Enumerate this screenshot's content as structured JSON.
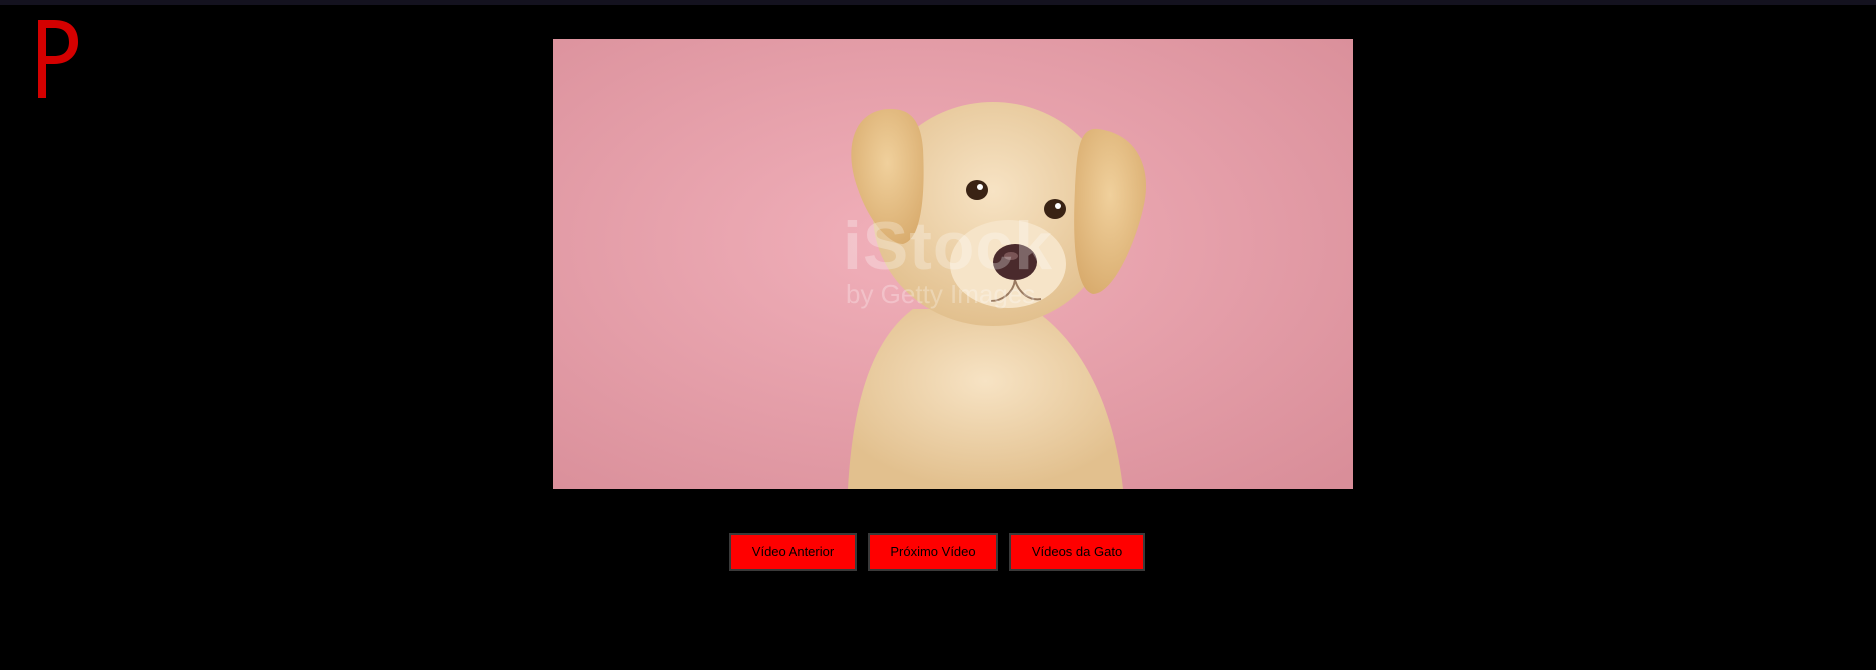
{
  "app": {
    "logo": {
      "icon": "brand-p-logo",
      "letter": "P",
      "color": "#d40000"
    }
  },
  "player": {
    "media": {
      "icon": "puppy-thumbnail",
      "background": "#e8a3ad",
      "watermark": "iStock",
      "watermark_sub": "by Getty Images"
    }
  },
  "controls": {
    "prev_label": "Vídeo Anterior",
    "next_label": "Próximo Vídeo",
    "cats_label": "Vídeos da Gato",
    "button_color": "#ff0000"
  }
}
